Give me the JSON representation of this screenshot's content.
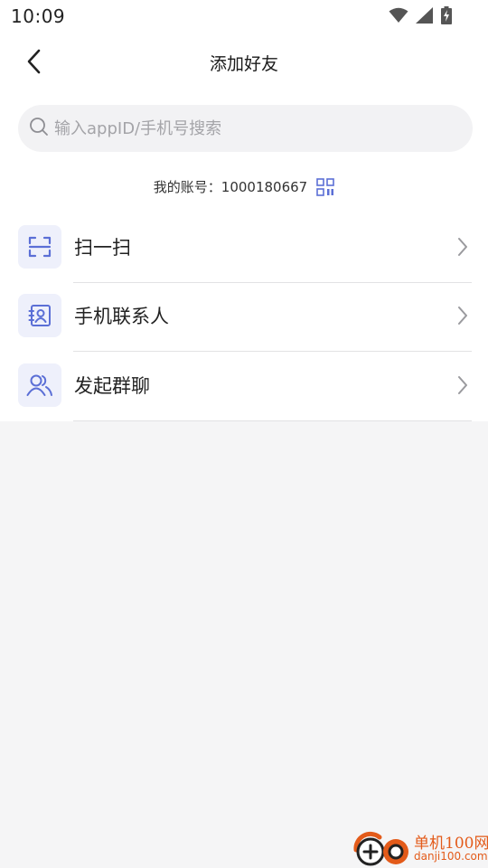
{
  "status_bar": {
    "time": "10:09",
    "icons": [
      "wifi-icon",
      "signal-icon",
      "battery-charging-icon"
    ]
  },
  "header": {
    "title": "添加好友",
    "back_icon": "chevron-left-icon"
  },
  "search": {
    "placeholder": "输入appID/手机号搜索",
    "value": ""
  },
  "account": {
    "label": "我的账号：",
    "id": "1000180667",
    "qr_icon": "qr-code-icon"
  },
  "menu": [
    {
      "label": "扫一扫",
      "icon": "scan-icon"
    },
    {
      "label": "手机联系人",
      "icon": "contacts-book-icon"
    },
    {
      "label": "发起群聊",
      "icon": "group-users-icon"
    }
  ],
  "watermark": {
    "brand": "单机100网",
    "domain": "danji100.com"
  },
  "colors": {
    "accent": "#5b6fd6",
    "icon_bg": "#eef0fb",
    "page_bg": "#f5f5f6",
    "watermark": "#e35b1a"
  }
}
